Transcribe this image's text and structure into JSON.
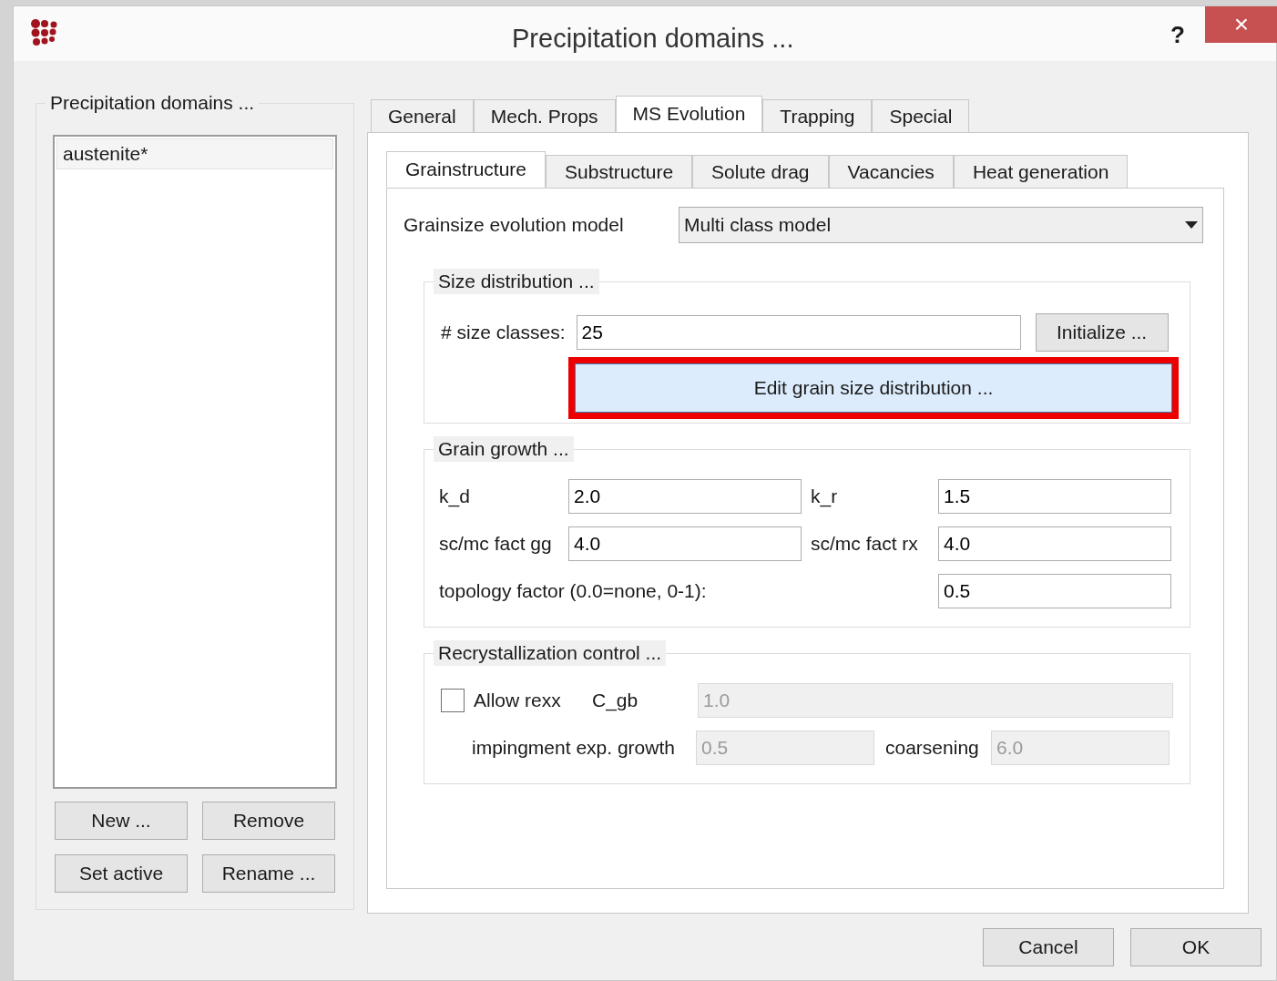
{
  "window": {
    "title": "Precipitation domains ...",
    "help": "?",
    "close": "×"
  },
  "domains": {
    "title": "Precipitation domains ...",
    "items": [
      {
        "label": "austenite*",
        "selected": true
      }
    ],
    "buttons": [
      "New ...",
      "Remove",
      "Set active",
      "Rename ..."
    ]
  },
  "tabs": [
    {
      "label": "General",
      "selected": false
    },
    {
      "label": "Mech. Props",
      "selected": false
    },
    {
      "label": "MS Evolution",
      "selected": true
    },
    {
      "label": "Trapping",
      "selected": false
    },
    {
      "label": "Special",
      "selected": false
    }
  ],
  "subtabs": [
    {
      "label": "Grainstructure",
      "selected": true
    },
    {
      "label": "Substructure",
      "selected": false
    },
    {
      "label": "Solute drag",
      "selected": false
    },
    {
      "label": "Vacancies",
      "selected": false
    },
    {
      "label": "Heat generation",
      "selected": false
    }
  ],
  "model": {
    "label": "Grainsize evolution model",
    "value": "Multi class model"
  },
  "size_distribution": {
    "title": "Size distribution ...",
    "classes_label": "# size classes:",
    "classes_value": "25",
    "initialize": "Initialize ...",
    "edit": {
      "label": "Edit grain size distribution ...",
      "highlighted": true
    }
  },
  "grain_growth": {
    "title": "Grain growth ...",
    "k_d": {
      "label": "k_d",
      "value": "2.0"
    },
    "k_r": {
      "label": "k_r",
      "value": "1.5"
    },
    "fact_gg": {
      "label": "sc/mc fact gg",
      "value": "4.0"
    },
    "fact_rx": {
      "label": "sc/mc fact rx",
      "value": "4.0"
    },
    "topology": {
      "label": "topology factor (0.0=none, 0-1):",
      "value": "0.5"
    }
  },
  "recrystallization": {
    "title": "Recrystallization control ...",
    "allow": {
      "label": "Allow rexx",
      "checked": false
    },
    "c_gb": {
      "label": "C_gb",
      "value": "1.0",
      "disabled": true
    },
    "impingement": {
      "label": "impingment exp. growth",
      "value": "0.5",
      "disabled": true
    },
    "coarsening": {
      "label": "coarsening",
      "value": "6.0",
      "disabled": true
    }
  },
  "buttons": [
    "Cancel",
    "OK"
  ]
}
